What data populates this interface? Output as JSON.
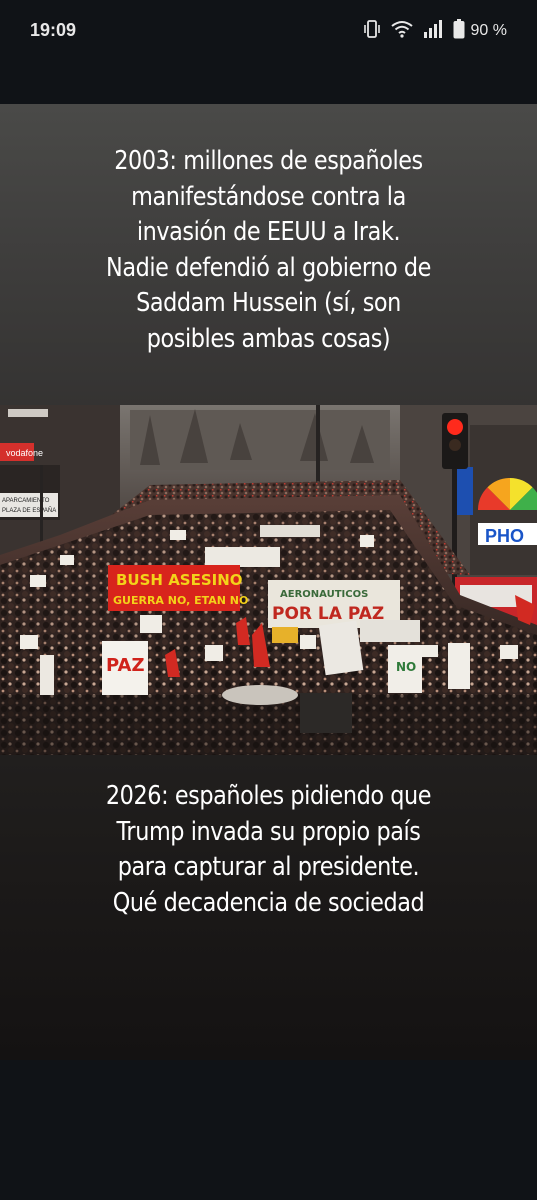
{
  "status_bar": {
    "time": "19:09",
    "battery_percent": "90 %",
    "icons": [
      "vibrate-icon",
      "wifi-icon",
      "signal-icon",
      "battery-icon"
    ]
  },
  "story": {
    "caption_top": "2003: millones de españoles\nmanifestándose contra la\ninvasión de EEUU a Irak.\nNadie defendió al gobierno de\nSaddam Hussein (sí, son\nposibles ambas cosas)",
    "caption_bottom": "2026: españoles pidiendo que\nTrump invada su propio país\npara capturar al presidente.\nQué decadencia de sociedad"
  },
  "photo": {
    "banner_left_line1": "BUSH ASESINO",
    "banner_left_line2": "GUERRA NO, ETAN NO",
    "banner_center_line1": "AERONAUTICOS",
    "banner_center_line2": "POR LA PAZ",
    "sign_paz": "PAZ",
    "sign_no": "NO",
    "storefront_sign": "PHO",
    "parking_sign": "APARCAMIENTO\nPLAZA DE ESPAÑA",
    "shop_sign": "vodafone"
  },
  "colors": {
    "background": "#101317",
    "status_text": "#e8e8e8",
    "caption_text": "#ffffff",
    "banner_red": "#d8241c",
    "banner_yellow": "#f3d21a"
  }
}
